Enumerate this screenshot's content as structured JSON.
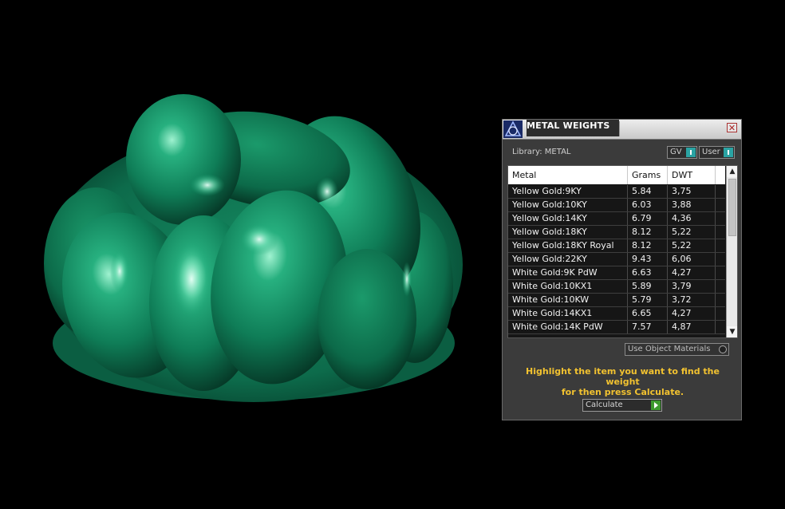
{
  "panel": {
    "title": "METAL WEIGHTS",
    "close_glyph": "✕",
    "library_label": "Library: METAL",
    "gv_label": "GV",
    "user_label": "User",
    "use_object_materials_label": "Use Object Materials",
    "instructions_line1": "Highlight the item you want to find the weight",
    "instructions_line2": "for then press Calculate.",
    "calculate_label": "Calculate"
  },
  "table": {
    "headers": {
      "metal": "Metal",
      "grams": "Grams",
      "dwt": "DWT"
    },
    "rows": [
      {
        "metal": "Yellow Gold:9KY",
        "grams": "5.84",
        "dwt": "3,75"
      },
      {
        "metal": "Yellow Gold:10KY",
        "grams": "6.03",
        "dwt": "3,88"
      },
      {
        "metal": "Yellow Gold:14KY",
        "grams": "6.79",
        "dwt": "4,36"
      },
      {
        "metal": "Yellow Gold:18KY",
        "grams": "8.12",
        "dwt": "5,22"
      },
      {
        "metal": "Yellow Gold:18KY Royal",
        "grams": "8.12",
        "dwt": "5,22"
      },
      {
        "metal": "Yellow Gold:22KY",
        "grams": "9.43",
        "dwt": "6,06"
      },
      {
        "metal": "White Gold:9K PdW",
        "grams": "6.63",
        "dwt": "4,27"
      },
      {
        "metal": "White Gold:10KX1",
        "grams": "5.89",
        "dwt": "3,79"
      },
      {
        "metal": "White Gold:10KW",
        "grams": "5.79",
        "dwt": "3,72"
      },
      {
        "metal": "White Gold:14KX1",
        "grams": "6.65",
        "dwt": "4,27"
      },
      {
        "metal": "White Gold:14K PdW",
        "grams": "7.57",
        "dwt": "4,87"
      }
    ]
  },
  "icons": {
    "logo": "app-logo-icon",
    "close": "close-icon",
    "toggle": "toggle-icon",
    "scroll_up": "▲",
    "scroll_down": "▼",
    "go": "play-arrow-icon"
  },
  "colors": {
    "model_green": "#0e7a57",
    "instructions": "#f2c230",
    "toggle_knob": "#2aa3a3",
    "go_button": "#3d9a2e"
  }
}
